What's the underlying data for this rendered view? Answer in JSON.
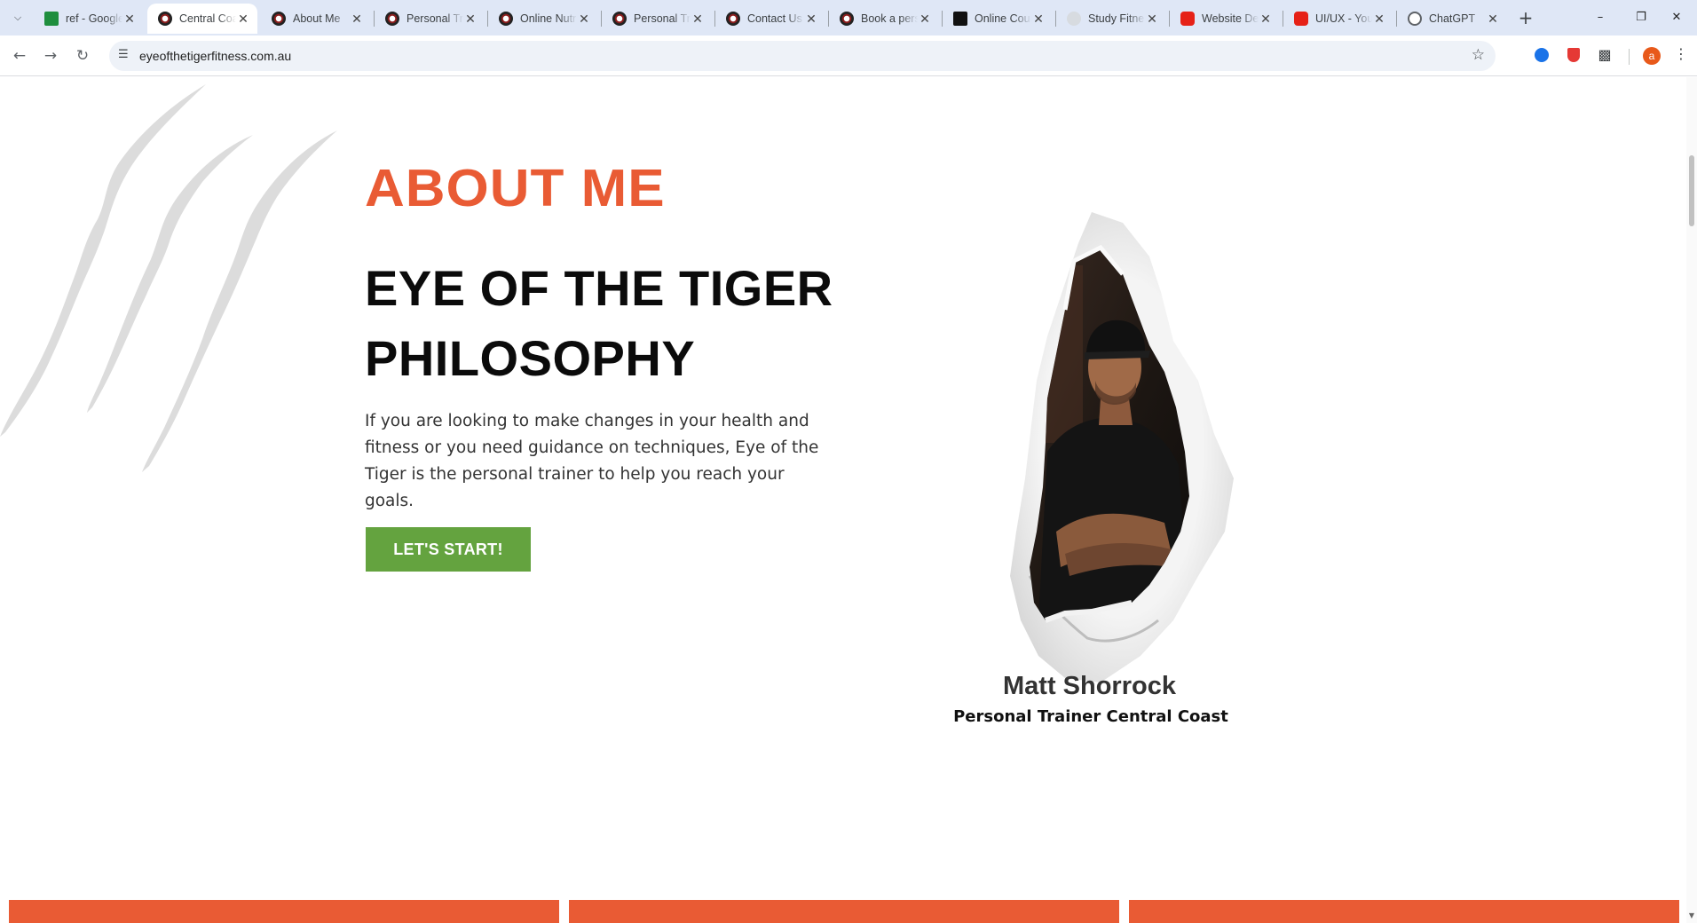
{
  "browser": {
    "tabs": [
      {
        "title": "ref - Google Sheets",
        "icon": "sheets-icon",
        "favclass": "fav-sheets"
      },
      {
        "title": "Central Coast",
        "icon": "tiger-site-icon",
        "favclass": "fav-tiger",
        "active": true
      },
      {
        "title": "About Me",
        "icon": "tiger-site-icon",
        "favclass": "fav-tiger"
      },
      {
        "title": "Personal Training",
        "icon": "tiger-site-icon",
        "favclass": "fav-tiger"
      },
      {
        "title": "Online Nutrition",
        "icon": "tiger-site-icon",
        "favclass": "fav-tiger"
      },
      {
        "title": "Personal Training",
        "icon": "tiger-site-icon",
        "favclass": "fav-tiger"
      },
      {
        "title": "Contact Us",
        "icon": "tiger-site-icon",
        "favclass": "fav-tiger"
      },
      {
        "title": "Book a personal",
        "icon": "tiger-site-icon",
        "favclass": "fav-tiger"
      },
      {
        "title": "Online Course",
        "icon": "black-square-icon",
        "favclass": "fav-black"
      },
      {
        "title": "Study Fitness",
        "icon": "study-icon",
        "favclass": "fav-study"
      },
      {
        "title": "Website Design",
        "icon": "youtube-icon",
        "favclass": "fav-yt"
      },
      {
        "title": "UI/UX - YouTube",
        "icon": "youtube-icon",
        "favclass": "fav-yt"
      },
      {
        "title": "ChatGPT",
        "icon": "chatgpt-icon",
        "favclass": "fav-gpt"
      }
    ],
    "url": "eyeofthetigerfitness.com.au",
    "avatar_letter": "a",
    "accent": "#e8591a"
  },
  "page": {
    "eyebrow": "ABOUT ME",
    "headline_line1": "EYE OF THE TIGER",
    "headline_line2": "PHILOSOPHY",
    "lead": "If you are looking to make changes in your health and fitness or you need guidance on techniques, Eye of the Tiger is the personal trainer to help you reach your goals.",
    "cta_label": "LET'S START!",
    "trainer_name": "Matt Shorrock",
    "trainer_role": "Personal Trainer Central Coast",
    "colors": {
      "orange": "#e95b34",
      "green": "#64a33f",
      "dark": "#0b0b0b"
    }
  }
}
